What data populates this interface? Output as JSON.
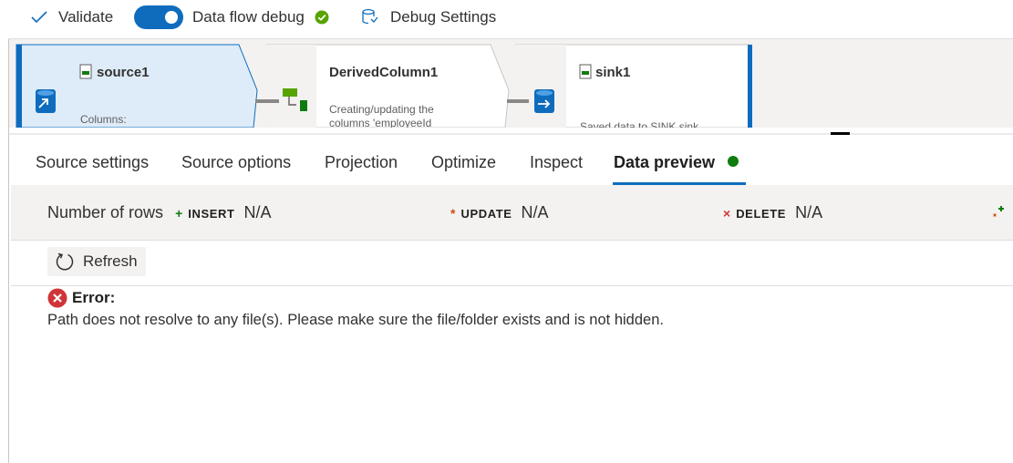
{
  "toolbar": {
    "validate_label": "Validate",
    "debug_label": "Data flow debug",
    "debug_on": true,
    "settings_label": "Debug Settings"
  },
  "canvas": {
    "nodes": [
      {
        "title": "source1",
        "subtitle": "Columns:"
      },
      {
        "title": "DerivedColumn1",
        "subtitle": "Creating/updating the columns 'employeeId"
      },
      {
        "title": "sink1",
        "subtitle": "Saved data to SINK sink"
      }
    ]
  },
  "tabs": [
    {
      "label": "Source settings"
    },
    {
      "label": "Source options"
    },
    {
      "label": "Projection"
    },
    {
      "label": "Optimize"
    },
    {
      "label": "Inspect"
    },
    {
      "label": "Data preview",
      "active": true
    }
  ],
  "stats": {
    "rows_label": "Number of rows",
    "insert": {
      "symbol": "+",
      "label": "INSERT",
      "value": "N/A"
    },
    "update": {
      "symbol": "*",
      "label": "UPDATE",
      "value": "N/A"
    },
    "delete": {
      "symbol": "×",
      "label": "DELETE",
      "value": "N/A"
    }
  },
  "refresh_label": "Refresh",
  "error": {
    "title": "Error:",
    "message": "Path does not resolve to any file(s). Please make sure the file/folder exists and is not hidden."
  },
  "colors": {
    "accent": "#0f6cbd",
    "success": "#107c10",
    "error": "#d13438",
    "selected_node": "#deecf9"
  }
}
